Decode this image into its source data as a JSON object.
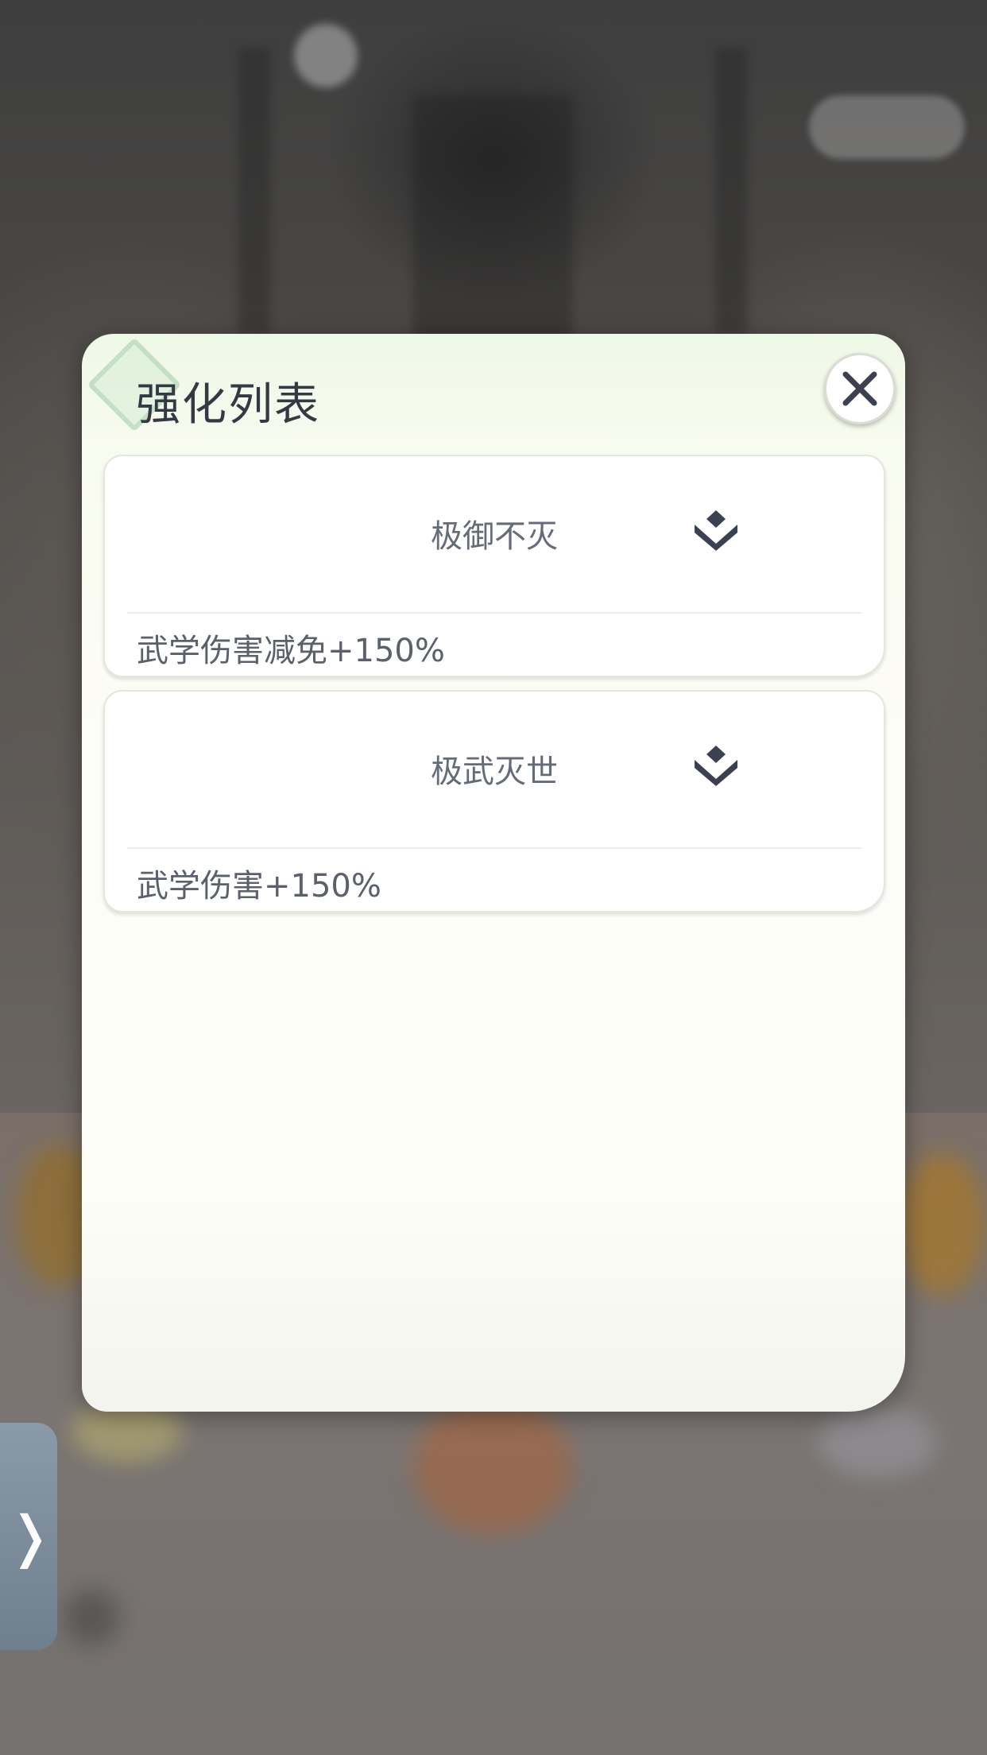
{
  "modal": {
    "title": "强化列表"
  },
  "enhancements": [
    {
      "name": "极御不灭",
      "effect": "武学伤害减免+150%"
    },
    {
      "name": "极武灭世",
      "effect": "武学伤害+150%"
    }
  ],
  "side_tab": {
    "label": "❭"
  },
  "icons": {
    "close": "close-icon",
    "rank": "chevron-diamond-icon"
  },
  "colors": {
    "modal_bg": "#fdfdf7",
    "text_dark": "#333a44",
    "icon_dark": "#3b4150"
  }
}
